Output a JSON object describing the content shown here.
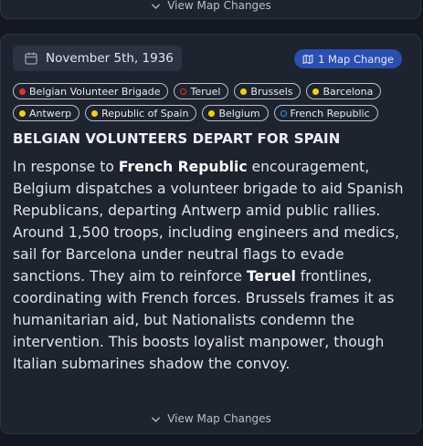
{
  "prev_card": {
    "toggle_label": "View Map Changes"
  },
  "event": {
    "date": "November 5th, 1936",
    "map_changes": "1 Map Change",
    "tags": [
      {
        "label": "Belgian Volunteer Brigade",
        "dot": "red"
      },
      {
        "label": "Teruel",
        "dot": "red-ring"
      },
      {
        "label": "Brussels",
        "dot": "yellow"
      },
      {
        "label": "Barcelona",
        "dot": "yellow"
      },
      {
        "label": "Antwerp",
        "dot": "yellow"
      },
      {
        "label": "Republic of Spain",
        "dot": "yellow"
      },
      {
        "label": "Belgium",
        "dot": "yellow"
      },
      {
        "label": "French Republic",
        "dot": "blue-ring"
      }
    ],
    "headline": "BELGIAN VOLUNTEERS DEPART FOR SPAIN",
    "body": {
      "p1": "In response to ",
      "b1": "French Republic",
      "p2": " encouragement, Belgium dispatches a volunteer brigade to aid Spanish Republicans, departing Antwerp amid public rallies. Around 1,500 troops, including engineers and medics, sail for Barcelona under neutral flags to evade sanctions. They aim to reinforce ",
      "b2": "Teruel",
      "p3": " frontlines, coordinating with French forces. Brussels frames it as humanitarian aid, but Nationalists condemn the intervention. This boosts loyalist manpower, though Italian submarines shadow the convoy."
    },
    "toggle_label": "View Map Changes"
  },
  "colors": {
    "background": "#141821",
    "card": "#1e2330",
    "badge": "#2b4fb0",
    "red": "#e5322d",
    "yellow": "#f1cf19",
    "blue": "#3b8ef0"
  }
}
